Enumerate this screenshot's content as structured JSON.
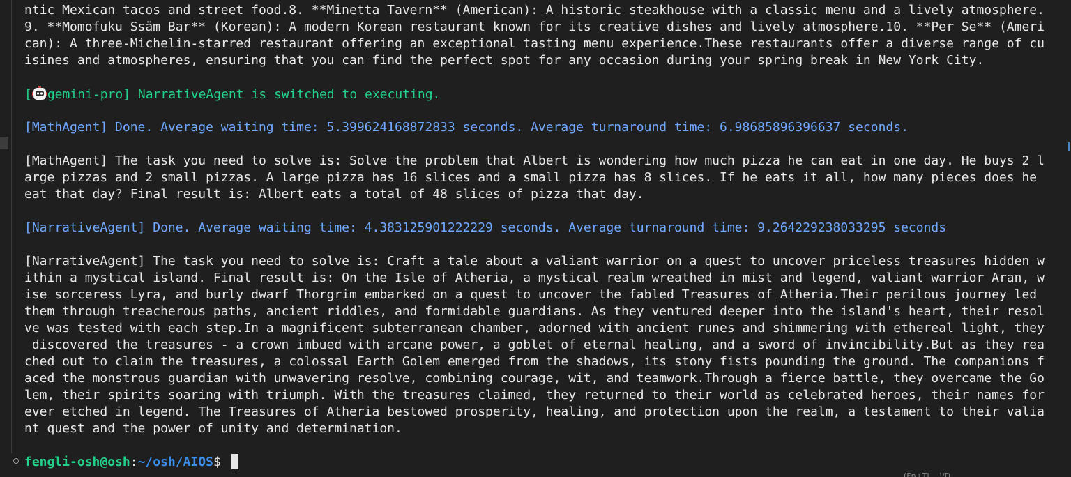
{
  "output": {
    "prev_lines": [
      "ntic Mexican tacos and street food.8. **Minetta Tavern** (American): A historic steakhouse with a classic menu and a lively atmosphere.",
      "9. **Momofuku Ssäm Bar** (Korean): A modern Korean restaurant known for its creative dishes and lively atmosphere.10. **Per Se** (Ameri",
      "can): A three-Michelin-starred restaurant offering an exceptional tasting menu experience.These restaurants offer a diverse range of cu",
      "isines and atmospheres, ensuring that you can find the perfect spot for any occasion during your spring break in New York City."
    ],
    "switch_prefix": "[",
    "switch_text": "gemini-pro] NarrativeAgent is switched to executing.",
    "math_done": "[MathAgent] Done. Average waiting time: 5.399624168872833 seconds. Average turnaround time: 6.98685896396637 seconds.",
    "math_task_lines": [
      "[MathAgent] The task you need to solve is: Solve the problem that Albert is wondering how much pizza he can eat in one day. He buys 2 l",
      "arge pizzas and 2 small pizzas. A large pizza has 16 slices and a small pizza has 8 slices. If he eats it all, how many pieces does he",
      "eat that day? Final result is: Albert eats a total of 48 slices of pizza that day."
    ],
    "narrative_done": "[NarrativeAgent] Done. Average waiting time: 4.383125901222229 seconds. Average turnaround time: 9.264229238033295 seconds",
    "narrative_task_lines": [
      "[NarrativeAgent] The task you need to solve is: Craft a tale about a valiant warrior on a quest to uncover priceless treasures hidden w",
      "ithin a mystical island. Final result is: On the Isle of Atheria, a mystical realm wreathed in mist and legend, valiant warrior Aran, w",
      "ise sorceress Lyra, and burly dwarf Thorgrim embarked on a quest to uncover the fabled Treasures of Atheria.Their perilous journey led",
      "them through treacherous paths, ancient riddles, and formidable guardians. As they ventured deeper into the island's heart, their resol",
      "ve was tested with each step.In a magnificent subterranean chamber, adorned with ancient runes and shimmering with ethereal light, they",
      " discovered the treasures - a crown imbued with arcane power, a goblet of eternal healing, and a sword of invincibility.But as they rea",
      "ched out to claim the treasures, a colossal Earth Golem emerged from the shadows, its stony fists pounding the ground. The companions f",
      "aced the monstrous guardian with unwavering resolve, combining courage, wit, and teamwork.Through a fierce battle, they overcame the Go",
      "lem, their spirits soaring with triumph. With the treasures claimed, they returned to their world as celebrated heroes, their names for",
      "ever etched in legend. The Treasures of Atheria bestowed prosperity, healing, and protection upon the realm, a testament to their valia",
      "nt quest and the power of unity and determination."
    ]
  },
  "prompt": {
    "user_host": "fengli-osh@osh",
    "colon": ":",
    "path": "~/osh/AIOS",
    "symbol": "$ "
  },
  "status_fragment": "(Fn+Tl... )/D...",
  "colors": {
    "background": "#1f1f1f",
    "green": "#23d18b",
    "blue": "#6fa8ff",
    "text": "#e6e6e6"
  },
  "icons": {
    "agent": "robot-icon"
  }
}
